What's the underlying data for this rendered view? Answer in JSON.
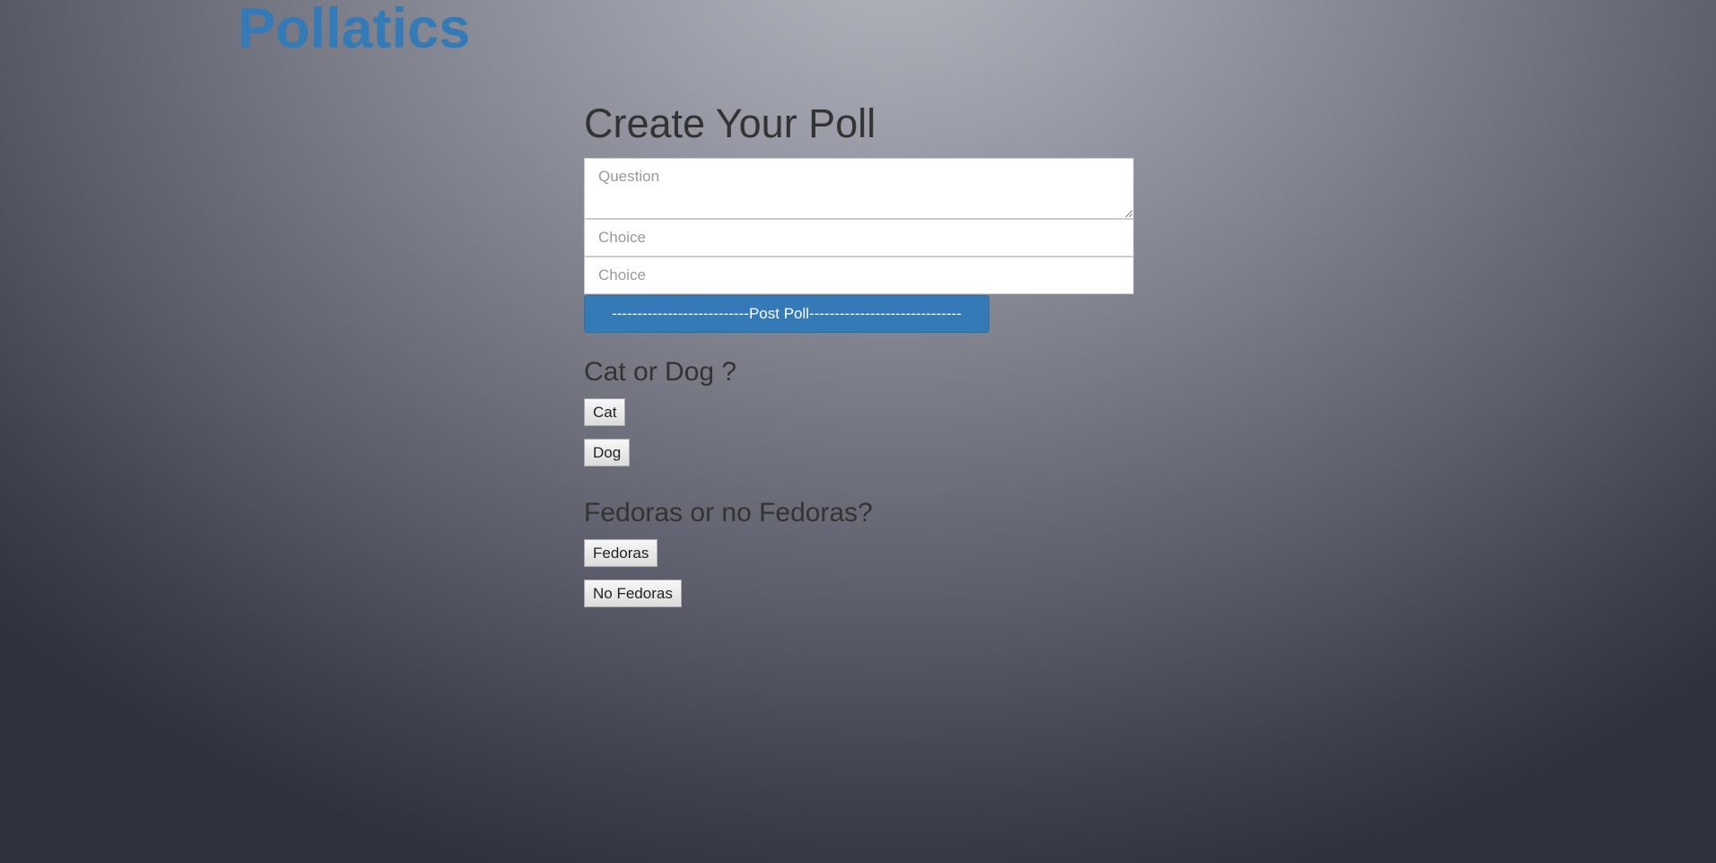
{
  "header": {
    "brand": "Pollatics",
    "brand_color": "#337ab7"
  },
  "create_poll": {
    "title": "Create Your Poll",
    "question_placeholder": "Question",
    "choice_placeholders": [
      "Choice",
      "Choice"
    ],
    "submit_label": "---------------------------Post Poll------------------------------",
    "submit_color": "#337ab7"
  },
  "polls": [
    {
      "question": "Cat or Dog ?",
      "choices": [
        "Cat",
        "Dog"
      ]
    },
    {
      "question": "Fedoras or no Fedoras?",
      "choices": [
        "Fedoras",
        "No Fedoras"
      ]
    }
  ]
}
